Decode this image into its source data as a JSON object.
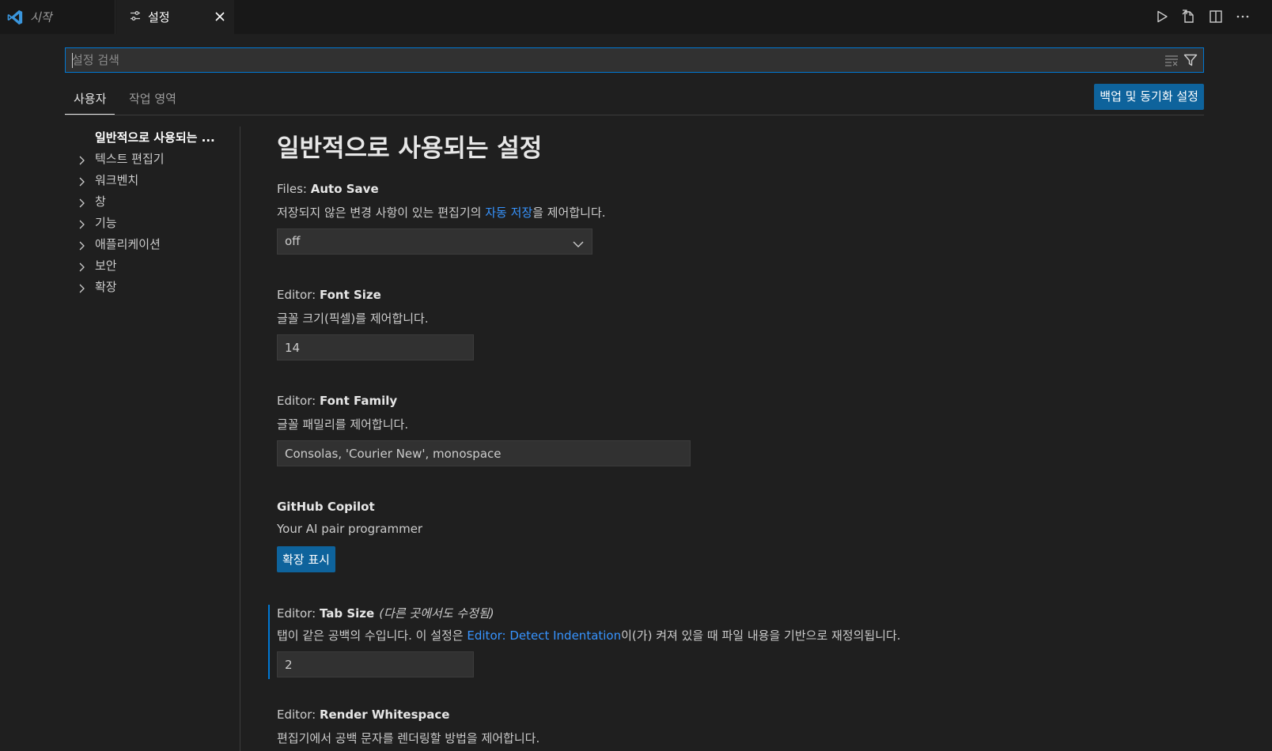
{
  "tabs": {
    "start": "시작",
    "settings": "설정"
  },
  "search": {
    "placeholder": "설정 검색"
  },
  "scope": {
    "user": "사용자",
    "workspace": "작업 영역",
    "sync_button": "백업 및 동기화 설정"
  },
  "toc": {
    "items": [
      {
        "label": "일반적으로 사용되는 ..."
      },
      {
        "label": "텍스트 편집기"
      },
      {
        "label": "워크벤치"
      },
      {
        "label": "창"
      },
      {
        "label": "기능"
      },
      {
        "label": "애플리케이션"
      },
      {
        "label": "보안"
      },
      {
        "label": "확장"
      }
    ]
  },
  "main": {
    "title": "일반적으로 사용되는 설정",
    "settings": [
      {
        "category": "Files: ",
        "name": "Auto Save",
        "desc_before": "저장되지 않은 변경 사항이 있는 편집기의 ",
        "desc_link": "자동 저장",
        "desc_after": "을 제어합니다.",
        "value": "off"
      },
      {
        "category": "Editor: ",
        "name": "Font Size",
        "desc": "글꼴 크기(픽셀)를 제어합니다.",
        "value": "14"
      },
      {
        "category": "Editor: ",
        "name": "Font Family",
        "desc": "글꼴 패밀리를 제어합니다.",
        "value": "Consolas, 'Courier New', monospace"
      },
      {
        "name": "GitHub Copilot",
        "desc": "Your AI pair programmer",
        "button": "확장 표시"
      },
      {
        "category": "Editor: ",
        "name": "Tab Size",
        "modified": "(다른 곳에서도 수정됨)",
        "desc_before": "탭이 같은 공백의 수입니다. 이 설정은 ",
        "desc_link": "Editor: Detect Indentation",
        "desc_after": "이(가) 켜져 있을 때 파일 내용을 기반으로 재정의됩니다.",
        "value": "2"
      },
      {
        "category": "Editor: ",
        "name": "Render Whitespace",
        "desc": "편집기에서 공백 문자를 렌더링할 방법을 제어합니다."
      }
    ]
  },
  "colors": {
    "accent": "#0078d4",
    "button": "#0e639c",
    "link": "#3794ff",
    "background": "#1f1f1f"
  }
}
